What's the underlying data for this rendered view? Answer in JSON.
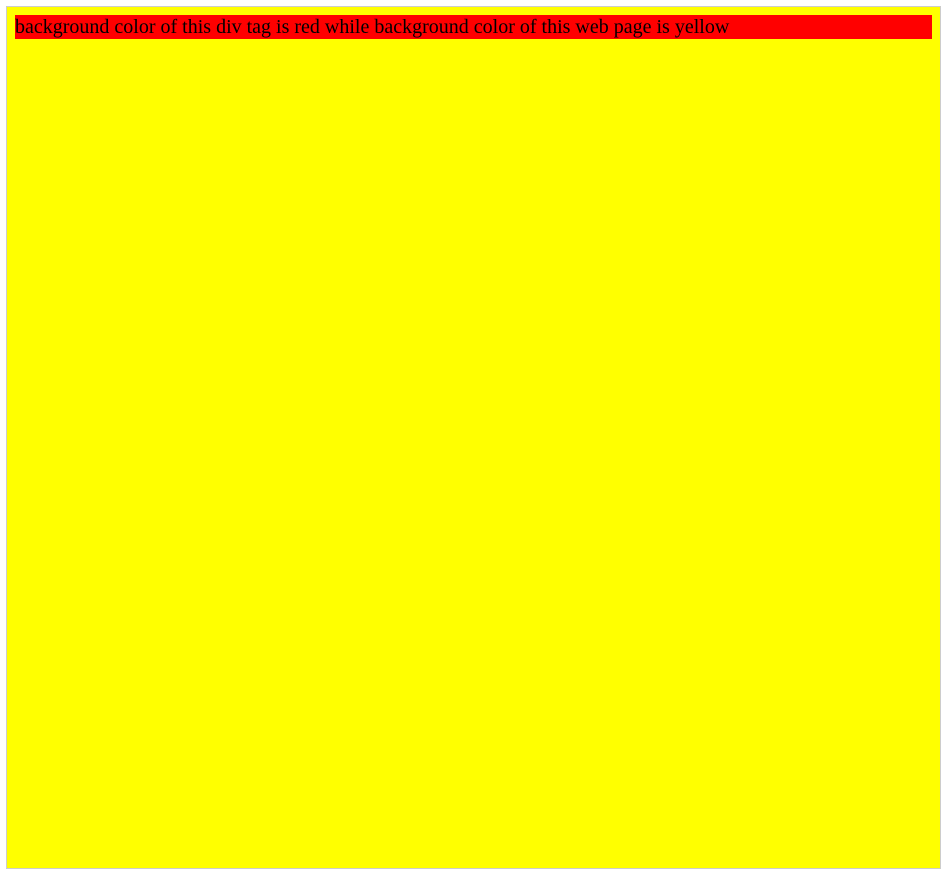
{
  "colors": {
    "page_bg": "#ffff00",
    "div_bg": "#ff0000"
  },
  "content": {
    "red_box_text": "background color of this div tag is red while background color of this web page is yellow"
  }
}
